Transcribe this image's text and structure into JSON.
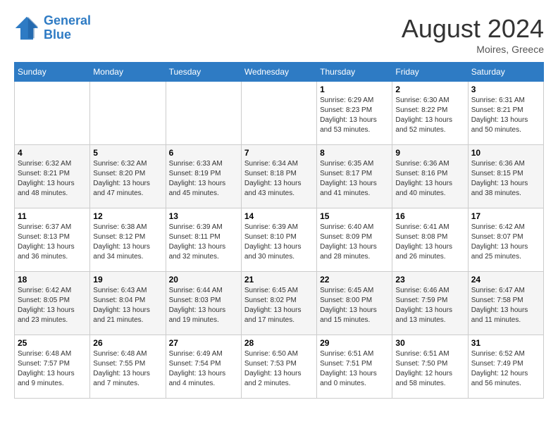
{
  "header": {
    "logo_line1": "General",
    "logo_line2": "Blue",
    "month_year": "August 2024",
    "location": "Moires, Greece"
  },
  "weekdays": [
    "Sunday",
    "Monday",
    "Tuesday",
    "Wednesday",
    "Thursday",
    "Friday",
    "Saturday"
  ],
  "weeks": [
    [
      {
        "day": "",
        "info": ""
      },
      {
        "day": "",
        "info": ""
      },
      {
        "day": "",
        "info": ""
      },
      {
        "day": "",
        "info": ""
      },
      {
        "day": "1",
        "info": "Sunrise: 6:29 AM\nSunset: 8:23 PM\nDaylight: 13 hours\nand 53 minutes."
      },
      {
        "day": "2",
        "info": "Sunrise: 6:30 AM\nSunset: 8:22 PM\nDaylight: 13 hours\nand 52 minutes."
      },
      {
        "day": "3",
        "info": "Sunrise: 6:31 AM\nSunset: 8:21 PM\nDaylight: 13 hours\nand 50 minutes."
      }
    ],
    [
      {
        "day": "4",
        "info": "Sunrise: 6:32 AM\nSunset: 8:21 PM\nDaylight: 13 hours\nand 48 minutes."
      },
      {
        "day": "5",
        "info": "Sunrise: 6:32 AM\nSunset: 8:20 PM\nDaylight: 13 hours\nand 47 minutes."
      },
      {
        "day": "6",
        "info": "Sunrise: 6:33 AM\nSunset: 8:19 PM\nDaylight: 13 hours\nand 45 minutes."
      },
      {
        "day": "7",
        "info": "Sunrise: 6:34 AM\nSunset: 8:18 PM\nDaylight: 13 hours\nand 43 minutes."
      },
      {
        "day": "8",
        "info": "Sunrise: 6:35 AM\nSunset: 8:17 PM\nDaylight: 13 hours\nand 41 minutes."
      },
      {
        "day": "9",
        "info": "Sunrise: 6:36 AM\nSunset: 8:16 PM\nDaylight: 13 hours\nand 40 minutes."
      },
      {
        "day": "10",
        "info": "Sunrise: 6:36 AM\nSunset: 8:15 PM\nDaylight: 13 hours\nand 38 minutes."
      }
    ],
    [
      {
        "day": "11",
        "info": "Sunrise: 6:37 AM\nSunset: 8:13 PM\nDaylight: 13 hours\nand 36 minutes."
      },
      {
        "day": "12",
        "info": "Sunrise: 6:38 AM\nSunset: 8:12 PM\nDaylight: 13 hours\nand 34 minutes."
      },
      {
        "day": "13",
        "info": "Sunrise: 6:39 AM\nSunset: 8:11 PM\nDaylight: 13 hours\nand 32 minutes."
      },
      {
        "day": "14",
        "info": "Sunrise: 6:39 AM\nSunset: 8:10 PM\nDaylight: 13 hours\nand 30 minutes."
      },
      {
        "day": "15",
        "info": "Sunrise: 6:40 AM\nSunset: 8:09 PM\nDaylight: 13 hours\nand 28 minutes."
      },
      {
        "day": "16",
        "info": "Sunrise: 6:41 AM\nSunset: 8:08 PM\nDaylight: 13 hours\nand 26 minutes."
      },
      {
        "day": "17",
        "info": "Sunrise: 6:42 AM\nSunset: 8:07 PM\nDaylight: 13 hours\nand 25 minutes."
      }
    ],
    [
      {
        "day": "18",
        "info": "Sunrise: 6:42 AM\nSunset: 8:05 PM\nDaylight: 13 hours\nand 23 minutes."
      },
      {
        "day": "19",
        "info": "Sunrise: 6:43 AM\nSunset: 8:04 PM\nDaylight: 13 hours\nand 21 minutes."
      },
      {
        "day": "20",
        "info": "Sunrise: 6:44 AM\nSunset: 8:03 PM\nDaylight: 13 hours\nand 19 minutes."
      },
      {
        "day": "21",
        "info": "Sunrise: 6:45 AM\nSunset: 8:02 PM\nDaylight: 13 hours\nand 17 minutes."
      },
      {
        "day": "22",
        "info": "Sunrise: 6:45 AM\nSunset: 8:00 PM\nDaylight: 13 hours\nand 15 minutes."
      },
      {
        "day": "23",
        "info": "Sunrise: 6:46 AM\nSunset: 7:59 PM\nDaylight: 13 hours\nand 13 minutes."
      },
      {
        "day": "24",
        "info": "Sunrise: 6:47 AM\nSunset: 7:58 PM\nDaylight: 13 hours\nand 11 minutes."
      }
    ],
    [
      {
        "day": "25",
        "info": "Sunrise: 6:48 AM\nSunset: 7:57 PM\nDaylight: 13 hours\nand 9 minutes."
      },
      {
        "day": "26",
        "info": "Sunrise: 6:48 AM\nSunset: 7:55 PM\nDaylight: 13 hours\nand 7 minutes."
      },
      {
        "day": "27",
        "info": "Sunrise: 6:49 AM\nSunset: 7:54 PM\nDaylight: 13 hours\nand 4 minutes."
      },
      {
        "day": "28",
        "info": "Sunrise: 6:50 AM\nSunset: 7:53 PM\nDaylight: 13 hours\nand 2 minutes."
      },
      {
        "day": "29",
        "info": "Sunrise: 6:51 AM\nSunset: 7:51 PM\nDaylight: 13 hours\nand 0 minutes."
      },
      {
        "day": "30",
        "info": "Sunrise: 6:51 AM\nSunset: 7:50 PM\nDaylight: 12 hours\nand 58 minutes."
      },
      {
        "day": "31",
        "info": "Sunrise: 6:52 AM\nSunset: 7:49 PM\nDaylight: 12 hours\nand 56 minutes."
      }
    ]
  ]
}
